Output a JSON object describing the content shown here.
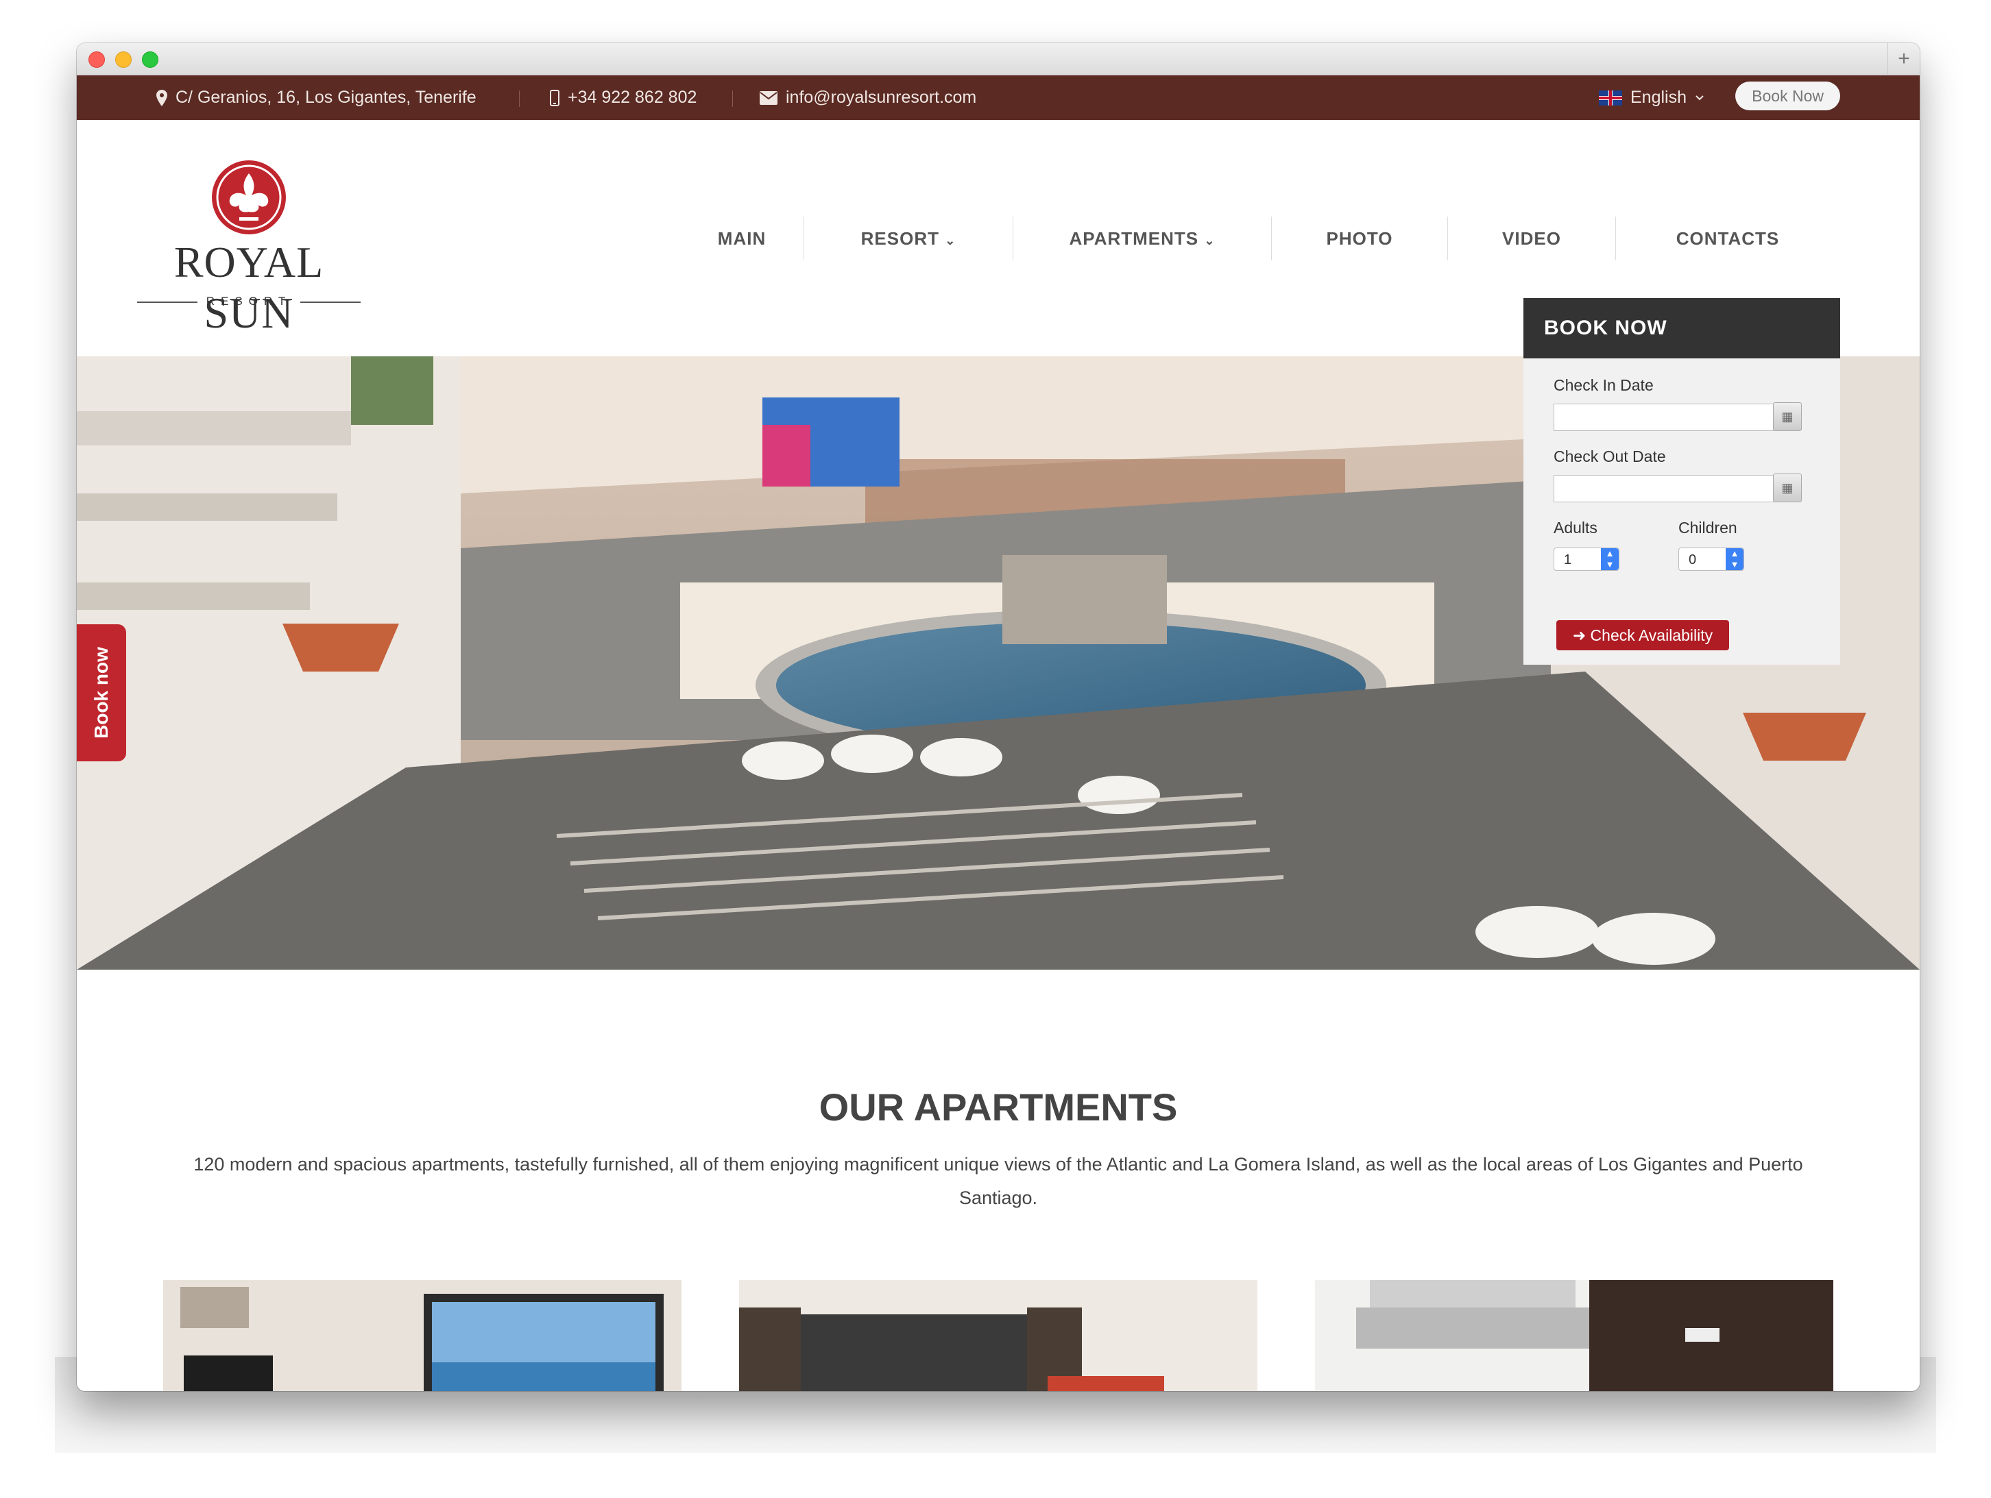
{
  "topbar": {
    "address": "C/ Geranios, 16, Los Gigantes, Tenerife",
    "phone": "+34 922 862 802",
    "email": "info@royalsunresort.com",
    "language": "English",
    "book_now": "Book Now"
  },
  "logo": {
    "word": "ROYAL SUN",
    "sub": "RESORT"
  },
  "nav": [
    {
      "label": "MAIN"
    },
    {
      "label": "RESORT"
    },
    {
      "label": "APARTMENTS"
    },
    {
      "label": "PHOTO"
    },
    {
      "label": "VIDEO"
    },
    {
      "label": "CONTACTS"
    }
  ],
  "side_tab": "Book now",
  "booking": {
    "title": "BOOK NOW",
    "check_in_label": "Check In Date",
    "check_in_value": "",
    "check_out_label": "Check Out Date",
    "check_out_value": "",
    "adults_label": "Adults",
    "adults_value": "1",
    "children_label": "Children",
    "children_value": "0",
    "submit": "Check Availability"
  },
  "apartments": {
    "title": "OUR APARTMENTS",
    "description": "120 modern and spacious apartments, tastefully furnished, all of them enjoying magnificent unique views of the Atlantic and La Gomera Island, as well as the local areas of Los Gigantes and Puerto Santiago."
  },
  "colors": {
    "topbar": "#5a2a23",
    "accent": "#c0262e",
    "panel_header": "#333333"
  }
}
